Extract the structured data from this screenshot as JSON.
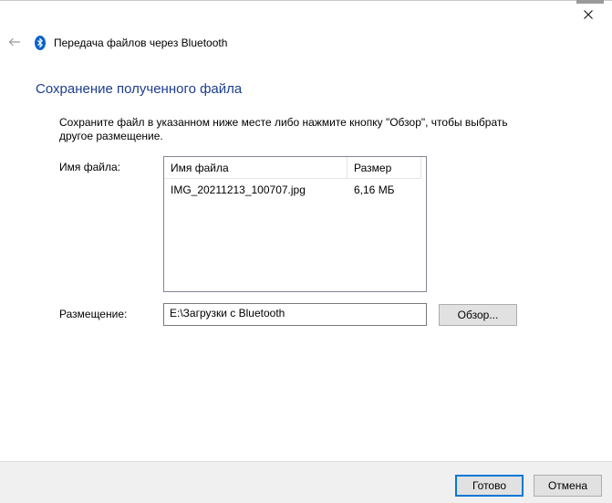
{
  "window": {
    "title": "Передача файлов через Bluetooth",
    "icons": {
      "back": "back-arrow-icon",
      "close": "close-icon",
      "app": "bluetooth-icon"
    },
    "colors": {
      "accent": "#0078d7",
      "title": "#1c3d8f",
      "bluetooth": "#0a63c9"
    }
  },
  "page": {
    "title": "Сохранение полученного файла",
    "instruction": "Сохраните файл в указанном ниже месте либо нажмите кнопку \"Обзор\", чтобы выбрать другое размещение."
  },
  "files": {
    "label": "Имя файла:",
    "columns": {
      "name": "Имя файла",
      "size": "Размер"
    },
    "rows": [
      {
        "name": "IMG_20211213_100707.jpg",
        "size": "6,16 МБ"
      }
    ]
  },
  "location": {
    "label": "Размещение:",
    "value": "E:\\Загрузки с Bluetooth",
    "browse_label": "Обзор..."
  },
  "footer": {
    "done_label": "Готово",
    "cancel_label": "Отмена"
  }
}
